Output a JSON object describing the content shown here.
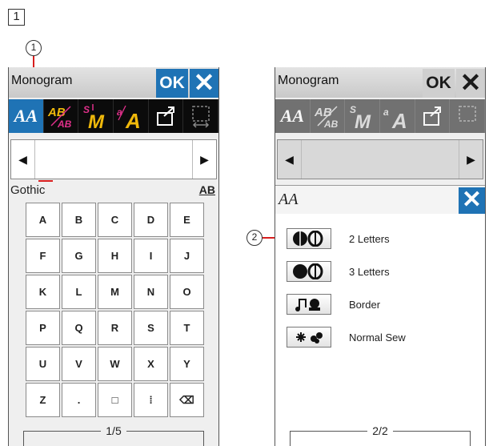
{
  "figure": {
    "step_number": "1",
    "callout_1": "1",
    "callout_2": "2"
  },
  "left_screen": {
    "title": "Monogram",
    "ok_label": "OK",
    "close_label": "✕",
    "toolbar": [
      "AA",
      "AB",
      "M",
      "A",
      "export",
      "select"
    ],
    "arrow_left": "◀",
    "arrow_right": "▶",
    "font_name": "Gothic",
    "ab_button": "AB",
    "keys": [
      "A",
      "B",
      "C",
      "D",
      "E",
      "F",
      "G",
      "H",
      "I",
      "J",
      "K",
      "L",
      "M",
      "N",
      "O",
      "P",
      "Q",
      "R",
      "S",
      "T",
      "U",
      "V",
      "W",
      "X",
      "Y",
      "Z",
      ".",
      "□",
      "⁞",
      "⌫"
    ],
    "pager": "1/5"
  },
  "right_screen": {
    "title": "Monogram",
    "ok_label": "OK",
    "close_label": "✕",
    "arrow_left": "◀",
    "arrow_right": "▶",
    "submenu_title": "AA",
    "submenu_close": "✕",
    "options": [
      {
        "label": "2 Letters",
        "icon": "two-letter-monogram-icon"
      },
      {
        "label": "3 Letters",
        "icon": "three-letter-monogram-icon"
      },
      {
        "label": "Border",
        "icon": "border-icon"
      },
      {
        "label": "Normal Sew",
        "icon": "normal-sew-icon"
      }
    ],
    "pager": "2/2"
  },
  "colors": {
    "accent": "#1f73b5",
    "toolbar": "#0b0b0b",
    "cursor": "#d81e1e",
    "letter_gold": "#f0b90b",
    "letter_pink": "#e0308a"
  }
}
